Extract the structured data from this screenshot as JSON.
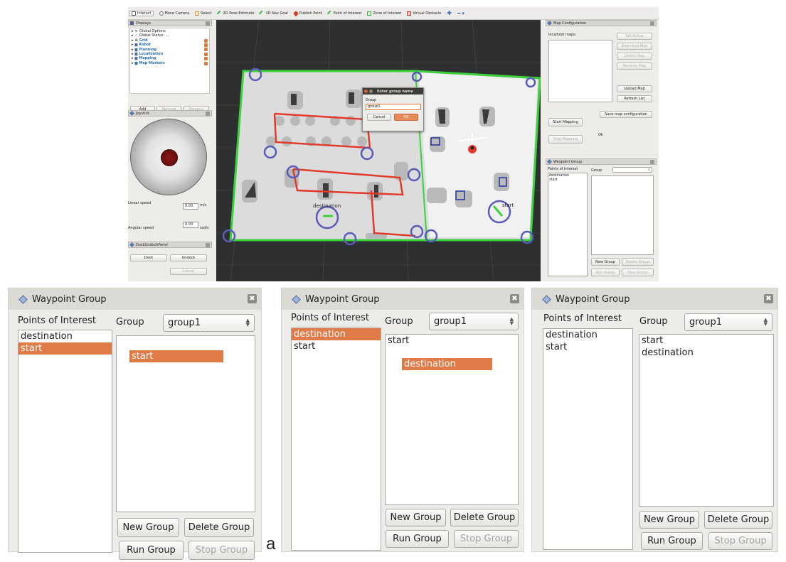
{
  "toolbar": {
    "items": [
      "Interact",
      "Move Camera",
      "Select",
      "2D Pose Estimate",
      "2D Nav Goal",
      "Publish Point",
      "Point of Interest",
      "Zone of Interest",
      "Virtual Obstacle"
    ]
  },
  "displays": {
    "title": "Displays",
    "items": [
      "Global Options",
      "Global Status: ...",
      "Grid",
      "Robot",
      "Planning",
      "Localization",
      "Mapping",
      "Map Markers"
    ],
    "buttons": [
      "Add",
      "Remove",
      "Rename"
    ]
  },
  "joystick": {
    "title": "Joystick",
    "linear_label": "Linear speed",
    "linear_value": "0.00",
    "linear_unit": "m/s",
    "angular_label": "Angular speed",
    "angular_value": "0.00",
    "angular_unit": "rad/s"
  },
  "dock": {
    "title": "DockUndockPanel",
    "dock": "Dock",
    "undock": "Undock",
    "cancel": "Cancel"
  },
  "dialog": {
    "title": "Enter group name",
    "label": "Group",
    "value": "group1",
    "cancel": "Cancel",
    "ok": "OK"
  },
  "map_labels": {
    "destination": "destination",
    "start": "start"
  },
  "map_config": {
    "title": "Map Configuration",
    "maps_label": "localhost maps:",
    "set_active": "Set Active",
    "download_map": "Download Map",
    "delete_map": "Delete Map",
    "rename_map": "Rename Map",
    "upload_map": "Upload Map",
    "refresh_list": "Refresh List",
    "save_config": "Save map configuration",
    "start_mapping": "Start Mapping",
    "stop_mapping": "Stop Mapping",
    "status": "Ok"
  },
  "small_waypoint": {
    "title": "Waypoint Group",
    "poi_label": "Points of Interest",
    "group_label": "Group",
    "poi": [
      "destination",
      "start"
    ],
    "new_group": "New Group",
    "delete_group": "Delete Group",
    "run_group": "Run Group",
    "stop_group": "Stop Group"
  },
  "panels": [
    {
      "title": "Waypoint Group",
      "poi_label": "Points of Interest",
      "group_label": "Group",
      "group_value": "group1",
      "poi": [
        "destination",
        "start"
      ],
      "selected": "start",
      "group_items": [],
      "dragging": "start",
      "new_group": "New Group",
      "delete_group": "Delete Group",
      "run_group": "Run Group",
      "stop_group": "Stop Group"
    },
    {
      "title": "Waypoint Group",
      "poi_label": "Points of Interest",
      "group_label": "Group",
      "group_value": "group1",
      "poi": [
        "destination",
        "start"
      ],
      "selected": "destination",
      "group_items": [
        "start"
      ],
      "dragging": "destination",
      "new_group": "New Group",
      "delete_group": "Delete Group",
      "run_group": "Run Group",
      "stop_group": "Stop Group"
    },
    {
      "title": "Waypoint Group",
      "poi_label": "Points of Interest",
      "group_label": "Group",
      "group_value": "group1",
      "poi": [
        "destination",
        "start"
      ],
      "selected": "",
      "group_items": [
        "start",
        "destination"
      ],
      "dragging": "",
      "new_group": "New Group",
      "delete_group": "Delete Group",
      "run_group": "Run Group",
      "stop_group": "Stop Group"
    }
  ],
  "caption": "a",
  "colors": {
    "selection": "#e07b47",
    "map_border": "#3cd13c",
    "path": "#e03b2a",
    "marker": "#5a5ab8"
  }
}
